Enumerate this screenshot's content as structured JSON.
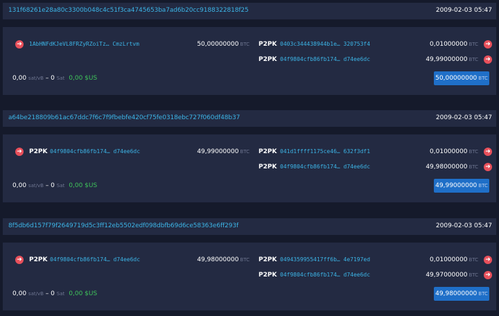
{
  "transactions": [
    {
      "txid": "131f68261e28a80c3300b048c4c51f3ca4745653ba7ad6b20cc9188322818f25",
      "time": "2009-02-03 05:47",
      "input": {
        "type": "",
        "address": "1AbHNFdKJeVL8FRZyRZoiTz… CmzLrtvm",
        "amount": "50,00000000",
        "unit": "BTC"
      },
      "outputs": [
        {
          "type": "P2PK",
          "address": "0403c344438944b1e… 320753f4",
          "amount": "0,01000000",
          "unit": "BTC"
        },
        {
          "type": "P2PK",
          "address": "04f9804cfb86fb174… d74ee6dc",
          "amount": "49,99000000",
          "unit": "BTC"
        }
      ],
      "fee": {
        "rate": "0,00",
        "rate_unit": "sat/vB",
        "dash": "–",
        "sat": "0",
        "sat_unit": "Sat",
        "usd": "0,00 $US"
      },
      "total": {
        "amount": "50,00000000",
        "unit": "BTC"
      }
    },
    {
      "txid": "a64be218809b61ac67ddc7f6c7f9fbebfe420cf75fe0318ebc727f060df48b37",
      "time": "2009-02-03 05:47",
      "input": {
        "type": "P2PK",
        "address": "04f9804cfb86fb174… d74ee6dc",
        "amount": "49,99000000",
        "unit": "BTC"
      },
      "outputs": [
        {
          "type": "P2PK",
          "address": "041d1ffff1175ce46… 632f3df1",
          "amount": "0,01000000",
          "unit": "BTC"
        },
        {
          "type": "P2PK",
          "address": "04f9804cfb86fb174… d74ee6dc",
          "amount": "49,98000000",
          "unit": "BTC"
        }
      ],
      "fee": {
        "rate": "0,00",
        "rate_unit": "sat/vB",
        "dash": "–",
        "sat": "0",
        "sat_unit": "Sat",
        "usd": "0,00 $US"
      },
      "total": {
        "amount": "49,99000000",
        "unit": "BTC"
      }
    },
    {
      "txid": "8f5db6d157f79f2649719d5c3ff12eb5502edf098dbfb69d6ce58363e6ff293f",
      "time": "2009-02-03 05:47",
      "input": {
        "type": "P2PK",
        "address": "04f9804cfb86fb174… d74ee6dc",
        "amount": "49,98000000",
        "unit": "BTC"
      },
      "outputs": [
        {
          "type": "P2PK",
          "address": "0494359955417ff6b… 4e7197ed",
          "amount": "0,01000000",
          "unit": "BTC"
        },
        {
          "type": "P2PK",
          "address": "04f9804cfb86fb174… d74ee6dc",
          "amount": "49,97000000",
          "unit": "BTC"
        }
      ],
      "fee": {
        "rate": "0,00",
        "rate_unit": "sat/vB",
        "dash": "–",
        "sat": "0",
        "sat_unit": "Sat",
        "usd": "0,00 $US"
      },
      "total": {
        "amount": "49,98000000",
        "unit": "BTC"
      }
    }
  ],
  "icons": {
    "arrow": "arrow-right-icon"
  },
  "colors": {
    "link": "#3cb4e6",
    "arrow": "#e8505b",
    "usd": "#3fc35a",
    "button": "#1f6fc8"
  },
  "glyphs": {
    "arrow": "➜"
  }
}
